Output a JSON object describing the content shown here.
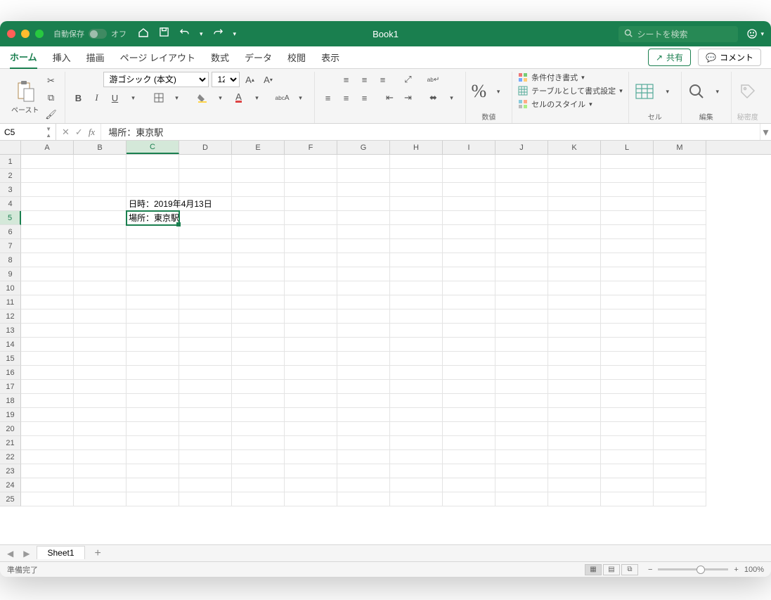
{
  "titlebar": {
    "autosave_label": "自動保存",
    "autosave_state": "オフ",
    "doc_title": "Book1",
    "search_placeholder": "シートを検索"
  },
  "tabs": {
    "home": "ホーム",
    "insert": "挿入",
    "draw": "描画",
    "pagelayout": "ページ レイアウト",
    "formulas": "数式",
    "data": "データ",
    "review": "校閲",
    "view": "表示",
    "share": "共有",
    "comment": "コメント"
  },
  "ribbon": {
    "paste": "ペースト",
    "font_name": "游ゴシック (本文)",
    "font_size": "12",
    "number_group": "数値",
    "cond_format": "条件付き書式",
    "format_table": "テーブルとして書式設定",
    "cell_styles": "セルのスタイル",
    "cells": "セル",
    "editing": "編集",
    "sensitivity": "秘密度"
  },
  "formula_bar": {
    "cell_ref": "C5",
    "formula": "場所：東京駅"
  },
  "grid": {
    "columns": [
      "A",
      "B",
      "C",
      "D",
      "E",
      "F",
      "G",
      "H",
      "I",
      "J",
      "K",
      "L",
      "M"
    ],
    "row_count": 25,
    "active_col": "C",
    "active_row": 5,
    "cells": {
      "C4": "日時：2019年4月13日",
      "C5": "場所：東京駅"
    }
  },
  "sheet_tabs": {
    "sheet1": "Sheet1"
  },
  "status": {
    "ready": "準備完了",
    "zoom": "100%"
  }
}
